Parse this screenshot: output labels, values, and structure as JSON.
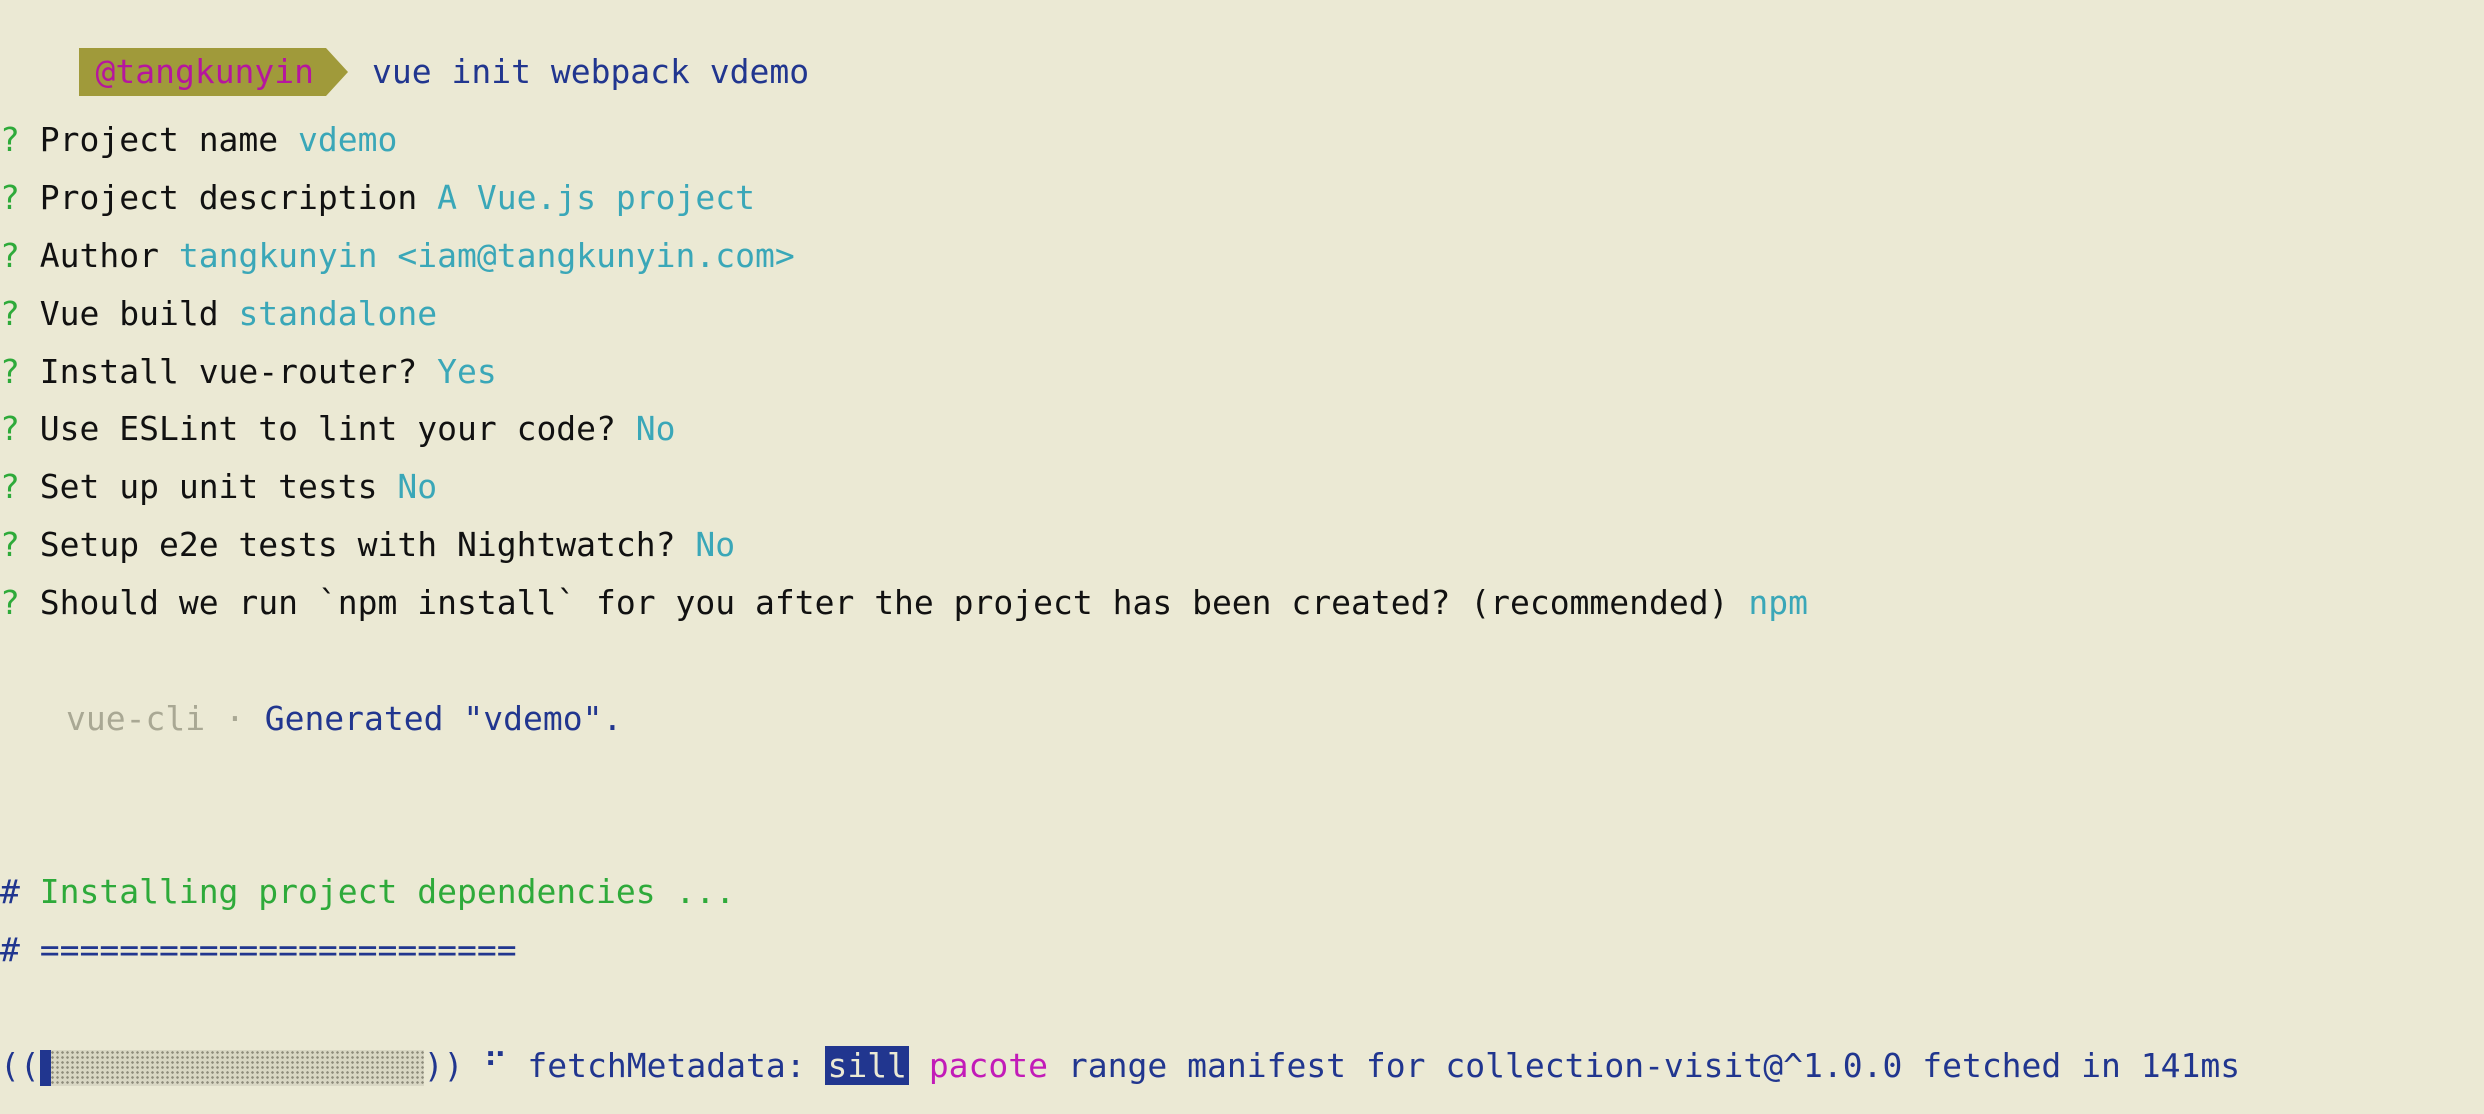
{
  "prompt": {
    "user": "@tangkunyin",
    "command": "vue init webpack vdemo"
  },
  "questions": [
    {
      "mark": "?",
      "label": "Project name",
      "answer": "vdemo"
    },
    {
      "mark": "?",
      "label": "Project description",
      "answer": "A Vue.js project"
    },
    {
      "mark": "?",
      "label": "Author",
      "answer": "tangkunyin <iam@tangkunyin.com>"
    },
    {
      "mark": "?",
      "label": "Vue build",
      "answer": "standalone"
    },
    {
      "mark": "?",
      "label": "Install vue-router?",
      "answer": "Yes"
    },
    {
      "mark": "?",
      "label": "Use ESLint to lint your code?",
      "answer": "No"
    },
    {
      "mark": "?",
      "label": "Set up unit tests",
      "answer": "No"
    },
    {
      "mark": "?",
      "label": "Setup e2e tests with Nightwatch?",
      "answer": "No"
    },
    {
      "mark": "?",
      "label": "Should we run `npm install` for you after the project has been created? (recommended)",
      "answer": "npm"
    }
  ],
  "generated": {
    "tool": "vue-cli",
    "separator": "·",
    "message": "Generated \"vdemo\"."
  },
  "install": {
    "heading_mark": "#",
    "heading": "Installing project dependencies ...",
    "rule_mark": "#",
    "rule": "========================"
  },
  "progress": {
    "open": "((",
    "close": "))",
    "fraction": 0.03,
    "spinner": "⠋",
    "task": "fetchMetadata:",
    "level": "sill",
    "module": "pacote",
    "message": "range manifest for collection-visit@^1.0.0 fetched in 141ms"
  },
  "colors": {
    "background": "#ebe9d4",
    "prompt_bg": "#a09a3a",
    "prompt_fg": "#b6169e",
    "command": "#21368f",
    "question_mark": "#2eaa3a",
    "answer": "#3aa7b8"
  }
}
